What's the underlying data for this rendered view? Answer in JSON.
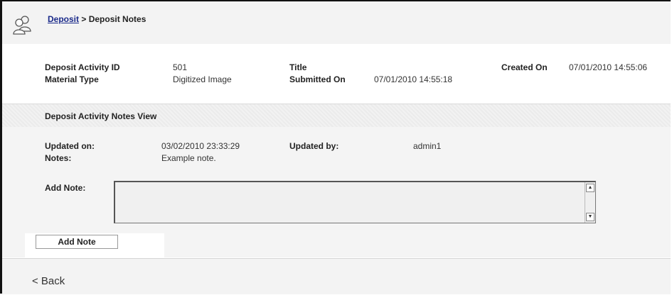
{
  "breadcrumb": {
    "parent": "Deposit",
    "separator": " > ",
    "current": "Deposit Notes"
  },
  "activity": {
    "id_label": "Deposit Activity ID",
    "id_value": "501",
    "material_label": "Material Type",
    "material_value": "Digitized Image",
    "title_label": "Title",
    "title_value": "",
    "submitted_label": "Submitted On",
    "submitted_value": "07/01/2010 14:55:18",
    "created_label": "Created On",
    "created_value": "07/01/2010 14:55:06"
  },
  "notes_view": {
    "section_title": "Deposit Activity Notes View",
    "updated_on_label": "Updated on:",
    "updated_on_value": "03/02/2010 23:33:29",
    "updated_by_label": "Updated by:",
    "updated_by_value": "admin1",
    "notes_label": "Notes:",
    "notes_value": "Example note.",
    "add_note_label": "Add Note:",
    "add_note_field_value": "",
    "add_note_button": "Add Note"
  },
  "footer": {
    "back_label": "< Back"
  },
  "icons": {
    "header": "users-icon"
  }
}
